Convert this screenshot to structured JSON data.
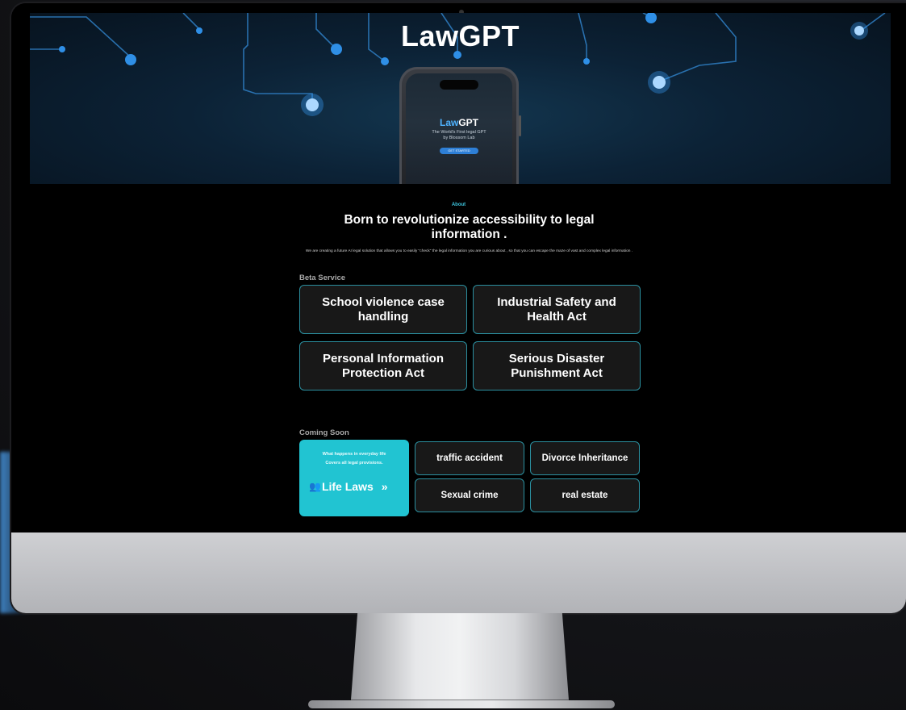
{
  "hero": {
    "title": "LawGPT",
    "phone": {
      "title_part1": "Law",
      "title_part2": "GPT",
      "subtitle_line1": "The World's First legal GPT",
      "subtitle_line2": "by Blossom Lab",
      "button_label": "GET STARTED"
    }
  },
  "about": {
    "tag": "About",
    "title_line1": "Born to revolutionize accessibility to legal",
    "title_line2": "information .",
    "description": "We are creating a future AI legal solution that allows you to easily \"check\" the legal information you are curious about , so that you can escape the maze of vast and complex legal information ."
  },
  "beta": {
    "label": "Beta Service",
    "items": [
      {
        "label": "School violence case handling"
      },
      {
        "label": "Industrial Safety and Health Act"
      },
      {
        "label": "Personal Information Protection Act"
      },
      {
        "label": "Serious Disaster Punishment Act"
      }
    ]
  },
  "coming_soon": {
    "label": "Coming Soon",
    "life_laws": {
      "description_line1": "What happens in everyday life",
      "description_line2": "Covers all legal provisions.",
      "icon": "people-icon",
      "icon_glyph": "👥",
      "title": "Life Laws",
      "arrow": "»"
    },
    "items": [
      {
        "label": "traffic accident"
      },
      {
        "label": "Divorce Inheritance"
      },
      {
        "label": "Sexual crime"
      },
      {
        "label": "real estate"
      }
    ]
  },
  "colors": {
    "accent": "#21c4d2",
    "card_border": "#2b8f9f",
    "card_bg": "#181818",
    "about_tag": "#3ec7e0"
  }
}
